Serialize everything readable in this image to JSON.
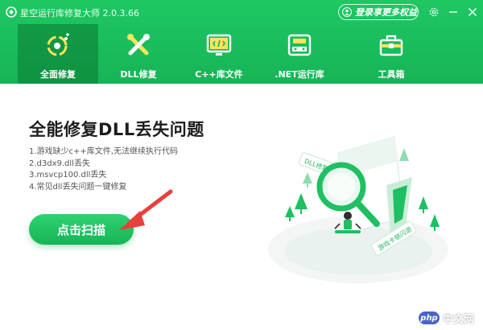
{
  "app": {
    "title": "星空运行库修复大师 2.0.3.66",
    "login_label": "登录享更多权益"
  },
  "tabs": [
    {
      "label": "全面修复",
      "icon": "full-repair-icon",
      "active": true
    },
    {
      "label": "DLL修复",
      "icon": "dll-tools-icon",
      "active": false
    },
    {
      "label": "C++库文件",
      "icon": "code-monitor-icon",
      "active": false
    },
    {
      "label": ".NET运行库",
      "icon": "net-runtime-icon",
      "active": false
    },
    {
      "label": "工具箱",
      "icon": "toolbox-icon",
      "active": false
    }
  ],
  "main": {
    "title": "全能修复DLL丢失问题",
    "issues": [
      "1.游戏缺少c++库文件,无法继续执行代码",
      "2.d3dx9.dll丢失",
      "3.msvcp100.dll丢失",
      "4.常见dll丢失问题一键修复"
    ],
    "scan_button": "点击扫描"
  },
  "illustration": {
    "tag_dll": "DLL修复",
    "tag_game": "游戏卡顿闪退"
  },
  "watermark": {
    "logo": "php",
    "text": "中文网"
  },
  "colors": {
    "brand": "#17b457",
    "active_tab": "#0d7d3a",
    "arrow": "#e8403c"
  }
}
